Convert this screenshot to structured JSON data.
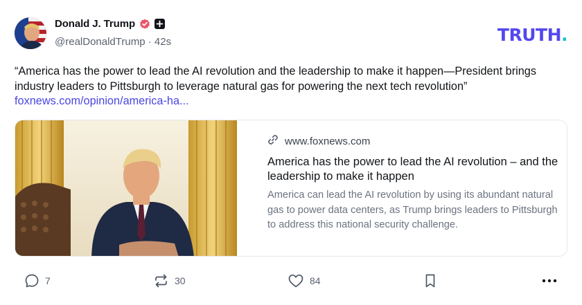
{
  "post": {
    "display_name": "Donald J. Trump",
    "handle": "@realDonaldTrump",
    "separator": "·",
    "time_ago": "42s",
    "text": "“America has the power to lead the AI revolution and the leadership to make it happen—President brings industry leaders to Pittsburgh to leverage natural gas for powering the next tech revolution”",
    "link_text": "foxnews.com/opinion/america-ha..."
  },
  "brand": {
    "logo_text": "TRUTH",
    "logo_dot": ".",
    "primary_color": "#5448ee",
    "dot_color": "#17c3cd"
  },
  "link_card": {
    "domain": "www.foxnews.com",
    "title": "America has the power to lead the AI revolution – and the leadership to make it happen",
    "description": "America can lead the AI revolution by using its abundant natural gas to power data centers, as Trump brings leaders to Pittsburgh to address this national security challenge."
  },
  "actions": {
    "replies": "7",
    "retruths": "30",
    "likes": "84"
  },
  "icons": {
    "verified": "verified-badge-icon",
    "plus": "plus-badge-icon",
    "link": "link-icon",
    "reply": "reply-icon",
    "retruth": "retruth-icon",
    "like": "heart-icon",
    "bookmark": "bookmark-icon",
    "more": "more-icon"
  }
}
